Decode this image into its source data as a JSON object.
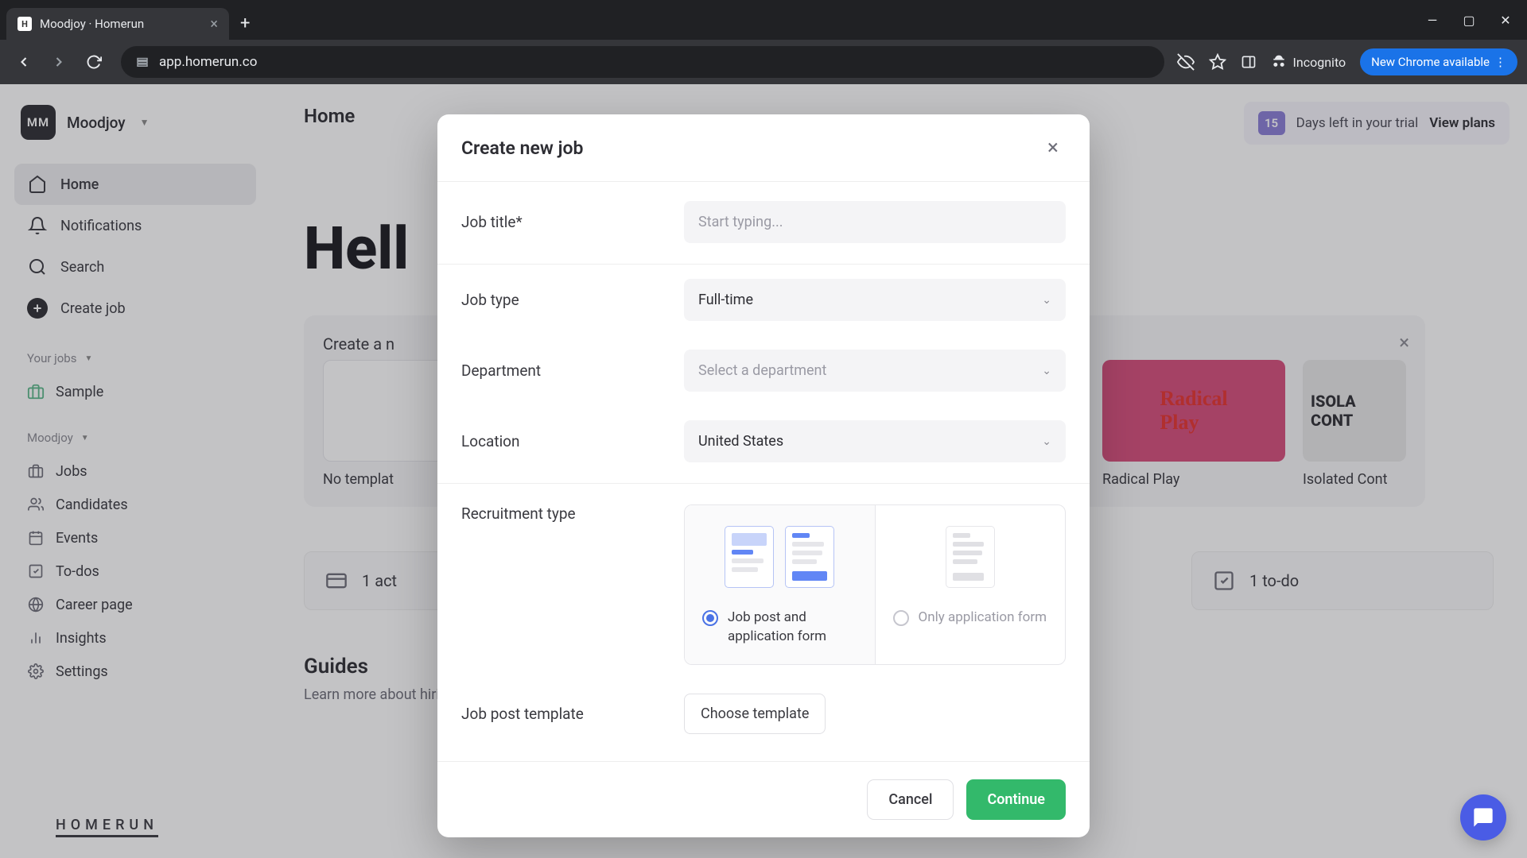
{
  "browser": {
    "tab_title": "Moodjoy · Homerun",
    "url": "app.homerun.co",
    "incognito": "Incognito",
    "update": "New Chrome available"
  },
  "account": {
    "initials": "MM",
    "name": "Moodjoy"
  },
  "nav": {
    "home": "Home",
    "notifications": "Notifications",
    "search": "Search",
    "create": "Create job"
  },
  "your_jobs_label": "Your jobs",
  "jobs": {
    "sample": "Sample"
  },
  "org_label": "Moodjoy",
  "links": {
    "jobs": "Jobs",
    "candidates": "Candidates",
    "events": "Events",
    "todos": "To-dos",
    "career": "Career page",
    "insights": "Insights",
    "settings": "Settings"
  },
  "logo": "HOMERUN",
  "page_title": "Home",
  "trial": {
    "days": "15",
    "text": "Days left in your trial",
    "cta": "View plans"
  },
  "hero": "Hell",
  "template_section_title": "Create a n",
  "template_blank": "No templat",
  "template_radical": "Radical Play",
  "template_isolated": "Isolated Cont",
  "stats": {
    "active": "1 act",
    "todo": "1 to-do"
  },
  "guides": {
    "title": "Guides",
    "sub": "Learn more about hiring mindfully by reading our guides"
  },
  "modal": {
    "title": "Create new job",
    "job_title_label": "Job title*",
    "job_title_placeholder": "Start typing...",
    "job_type_label": "Job type",
    "job_type_value": "Full-time",
    "dept_label": "Department",
    "dept_placeholder": "Select a department",
    "location_label": "Location",
    "location_value": "United States",
    "recruit_label": "Recruitment type",
    "opt1": "Job post and application form",
    "opt2": "Only application form",
    "template_label": "Job post template",
    "choose": "Choose template",
    "cancel": "Cancel",
    "continue": "Continue"
  }
}
